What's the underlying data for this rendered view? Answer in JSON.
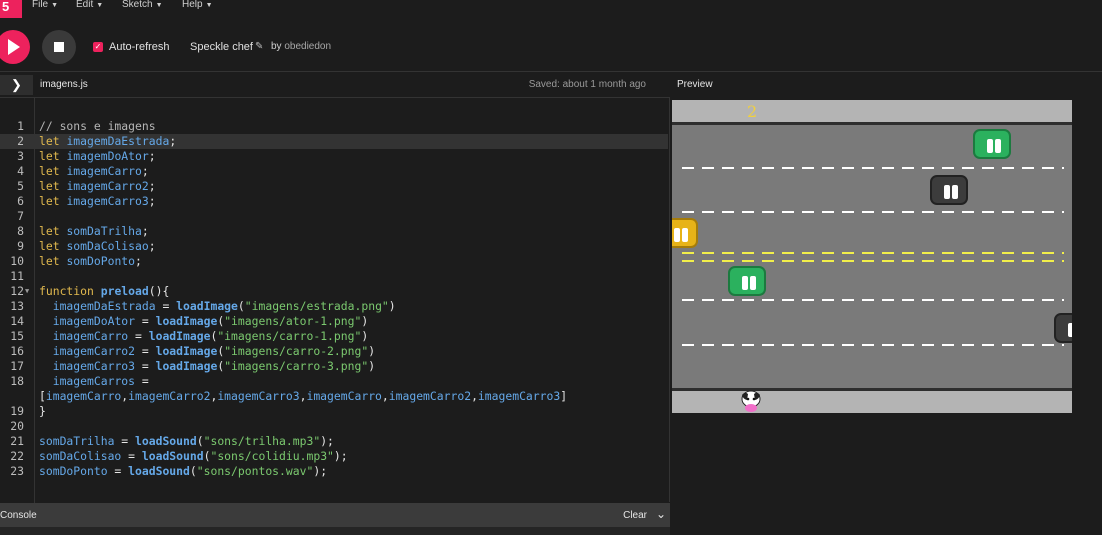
{
  "app": {
    "logo_text": "5"
  },
  "menu": [
    {
      "label": "File"
    },
    {
      "label": "Edit"
    },
    {
      "label": "Sketch"
    },
    {
      "label": "Help"
    }
  ],
  "toolbar": {
    "auto_refresh_label": "Auto-refresh",
    "auto_refresh_checked": true,
    "sketch_name": "Speckle chef",
    "by_label": "by",
    "author": "obediedon"
  },
  "editor": {
    "filename": "imagens.js",
    "saved_status": "Saved: about 1 month ago",
    "active_line": 2
  },
  "preview": {
    "label": "Preview",
    "score": "2"
  },
  "console": {
    "label": "Console",
    "clear_label": "Clear"
  },
  "code_lines": [
    {
      "n": "1",
      "tokens": [
        [
          "cm",
          "// sons e imagens"
        ]
      ]
    },
    {
      "n": "2",
      "tokens": [
        [
          "kw",
          "let "
        ],
        [
          "var",
          "imagemDaEstrada"
        ],
        [
          "pn",
          ";"
        ]
      ]
    },
    {
      "n": "3",
      "tokens": [
        [
          "kw",
          "let "
        ],
        [
          "var",
          "imagemDoAtor"
        ],
        [
          "pn",
          ";"
        ]
      ]
    },
    {
      "n": "4",
      "tokens": [
        [
          "kw",
          "let "
        ],
        [
          "var",
          "imagemCarro"
        ],
        [
          "pn",
          ";"
        ]
      ]
    },
    {
      "n": "5",
      "tokens": [
        [
          "kw",
          "let "
        ],
        [
          "var",
          "imagemCarro2"
        ],
        [
          "pn",
          ";"
        ]
      ]
    },
    {
      "n": "6",
      "tokens": [
        [
          "kw",
          "let "
        ],
        [
          "var",
          "imagemCarro3"
        ],
        [
          "pn",
          ";"
        ]
      ]
    },
    {
      "n": "7",
      "tokens": []
    },
    {
      "n": "8",
      "tokens": [
        [
          "kw",
          "let "
        ],
        [
          "var",
          "somDaTrilha"
        ],
        [
          "pn",
          ";"
        ]
      ]
    },
    {
      "n": "9",
      "tokens": [
        [
          "kw",
          "let "
        ],
        [
          "var",
          "somDaColisao"
        ],
        [
          "pn",
          ";"
        ]
      ]
    },
    {
      "n": "10",
      "tokens": [
        [
          "kw",
          "let "
        ],
        [
          "var",
          "somDoPonto"
        ],
        [
          "pn",
          ";"
        ]
      ]
    },
    {
      "n": "11",
      "tokens": []
    },
    {
      "n": "12",
      "fold": true,
      "tokens": [
        [
          "kw",
          "function "
        ],
        [
          "fn",
          "preload"
        ],
        [
          "pn",
          "(){"
        ]
      ]
    },
    {
      "n": "13",
      "tokens": [
        [
          "pn",
          "  "
        ],
        [
          "var",
          "imagemDaEstrada"
        ],
        [
          "pn",
          " = "
        ],
        [
          "fn",
          "loadImage"
        ],
        [
          "pn",
          "("
        ],
        [
          "str",
          "\"imagens/estrada.png\""
        ],
        [
          "pn",
          ")"
        ]
      ]
    },
    {
      "n": "14",
      "tokens": [
        [
          "pn",
          "  "
        ],
        [
          "var",
          "imagemDoAtor"
        ],
        [
          "pn",
          " = "
        ],
        [
          "fn",
          "loadImage"
        ],
        [
          "pn",
          "("
        ],
        [
          "str",
          "\"imagens/ator-1.png\""
        ],
        [
          "pn",
          ")"
        ]
      ]
    },
    {
      "n": "15",
      "tokens": [
        [
          "pn",
          "  "
        ],
        [
          "var",
          "imagemCarro"
        ],
        [
          "pn",
          " = "
        ],
        [
          "fn",
          "loadImage"
        ],
        [
          "pn",
          "("
        ],
        [
          "str",
          "\"imagens/carro-1.png\""
        ],
        [
          "pn",
          ")"
        ]
      ]
    },
    {
      "n": "16",
      "tokens": [
        [
          "pn",
          "  "
        ],
        [
          "var",
          "imagemCarro2"
        ],
        [
          "pn",
          " = "
        ],
        [
          "fn",
          "loadImage"
        ],
        [
          "pn",
          "("
        ],
        [
          "str",
          "\"imagens/carro-2.png\""
        ],
        [
          "pn",
          ")"
        ]
      ]
    },
    {
      "n": "17",
      "tokens": [
        [
          "pn",
          "  "
        ],
        [
          "var",
          "imagemCarro3"
        ],
        [
          "pn",
          " = "
        ],
        [
          "fn",
          "loadImage"
        ],
        [
          "pn",
          "("
        ],
        [
          "str",
          "\"imagens/carro-3.png\""
        ],
        [
          "pn",
          ")"
        ]
      ]
    },
    {
      "n": "18",
      "tokens": [
        [
          "pn",
          "  "
        ],
        [
          "var",
          "imagemCarros"
        ],
        [
          "pn",
          " ="
        ]
      ]
    },
    {
      "n": "",
      "wrap": true,
      "tokens": [
        [
          "pn",
          "["
        ],
        [
          "var",
          "imagemCarro"
        ],
        [
          "pn",
          ","
        ],
        [
          "var",
          "imagemCarro2"
        ],
        [
          "pn",
          ","
        ],
        [
          "var",
          "imagemCarro3"
        ],
        [
          "pn",
          ","
        ],
        [
          "var",
          "imagemCarro"
        ],
        [
          "pn",
          ","
        ],
        [
          "var",
          "imagemCarro2"
        ],
        [
          "pn",
          ","
        ],
        [
          "var",
          "imagemCarro3"
        ],
        [
          "pn",
          "]"
        ]
      ]
    },
    {
      "n": "19",
      "tokens": [
        [
          "pn",
          "}"
        ]
      ]
    },
    {
      "n": "20",
      "tokens": []
    },
    {
      "n": "21",
      "tokens": [
        [
          "var",
          "somDaTrilha"
        ],
        [
          "pn",
          " = "
        ],
        [
          "fn",
          "loadSound"
        ],
        [
          "pn",
          "("
        ],
        [
          "str",
          "\"sons/trilha.mp3\""
        ],
        [
          "pn",
          ");"
        ]
      ]
    },
    {
      "n": "22",
      "tokens": [
        [
          "var",
          "somDaColisao"
        ],
        [
          "pn",
          " = "
        ],
        [
          "fn",
          "loadSound"
        ],
        [
          "pn",
          "("
        ],
        [
          "str",
          "\"sons/colidiu.mp3\""
        ],
        [
          "pn",
          ");"
        ]
      ]
    },
    {
      "n": "23",
      "tokens": [
        [
          "var",
          "somDoPonto"
        ],
        [
          "pn",
          " = "
        ],
        [
          "fn",
          "loadSound"
        ],
        [
          "pn",
          "("
        ],
        [
          "str",
          "\"sons/pontos.wav\""
        ],
        [
          "pn",
          ");"
        ]
      ]
    }
  ],
  "colors": {
    "accent": "#ed225d",
    "keyword": "#e1b94e",
    "identifier": "#65a8e8",
    "string": "#7bc96f"
  }
}
